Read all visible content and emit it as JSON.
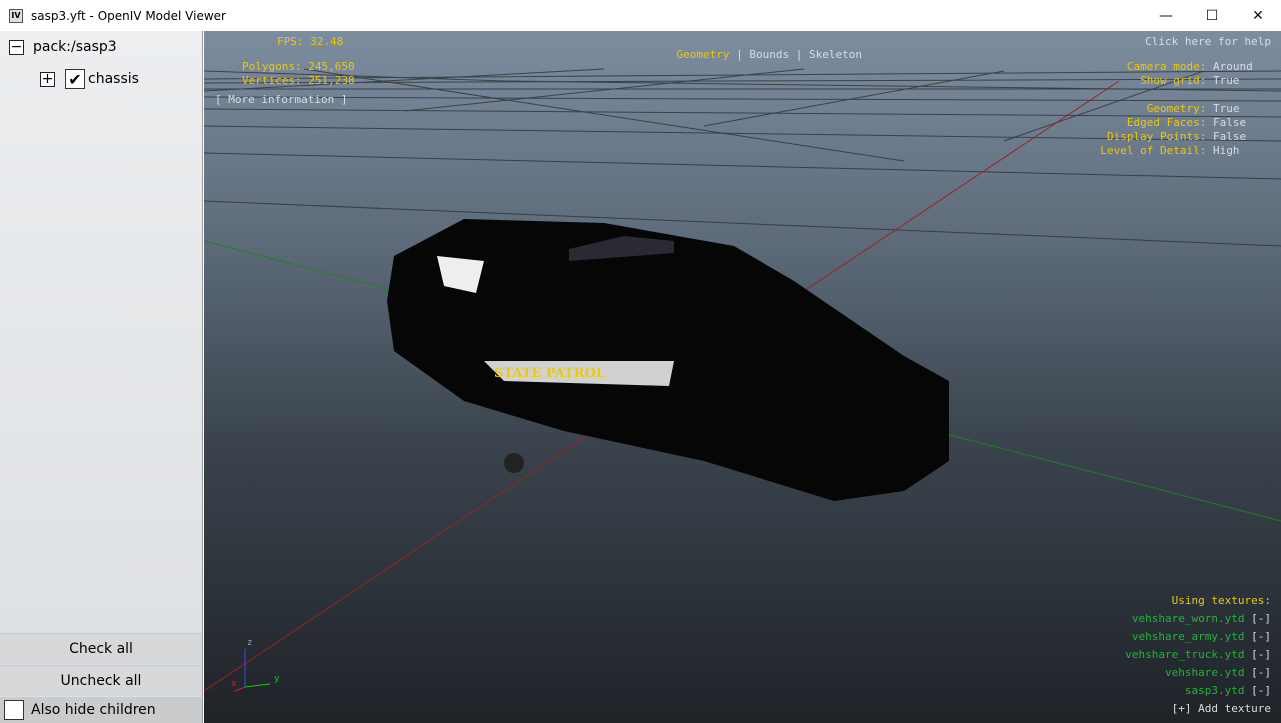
{
  "window": {
    "title": "sasp3.yft - OpenIV Model Viewer",
    "icon_text": "IV",
    "minimize": "—",
    "maximize": "☐",
    "close": "✕"
  },
  "tree": {
    "root": "pack:/sasp3",
    "child": "chassis"
  },
  "sidebar": {
    "check_all": "Check all",
    "uncheck_all": "Uncheck all",
    "also_hide_children": "Also hide children"
  },
  "hud": {
    "fps": "FPS: 32.48",
    "polygons": "Polygons: 245,650",
    "vertices": "Vertices: 251,238",
    "more_info": "[ More information ]",
    "modes": [
      "Geometry",
      "Bounds",
      "Skeleton"
    ],
    "help": "Click here for help",
    "settings": [
      {
        "label": "Camera mode:",
        "value": "Around"
      },
      {
        "label": "Show grid:",
        "value": "True"
      },
      {
        "label": "Geometry:",
        "value": "True"
      },
      {
        "label": "Edged Faces:",
        "value": "False"
      },
      {
        "label": "Display Points:",
        "value": "False"
      },
      {
        "label": "Level of Detail:",
        "value": "High"
      }
    ],
    "textures_title": "Using textures:",
    "textures": [
      "vehshare_worn.ytd",
      "vehshare_army.ytd",
      "vehshare_truck.ytd",
      "vehshare.ytd",
      "sasp3.ytd"
    ],
    "remove": "[-]",
    "add_texture": "[+] Add texture",
    "axes": {
      "z": "z",
      "x": "x",
      "y": "y"
    }
  },
  "colors": {
    "hud_yellow": "#e8c81a",
    "texture_green": "#29b03c"
  }
}
